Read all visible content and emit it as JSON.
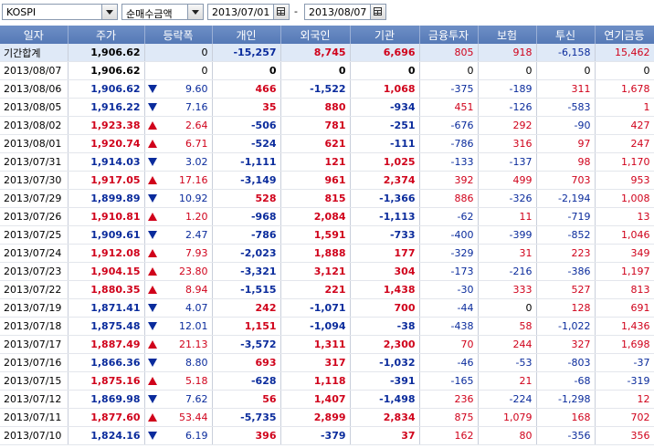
{
  "toolbar": {
    "index_select": "KOSPI",
    "type_select": "순매수금액",
    "start_date": "2013/07/01",
    "end_date": "2013/08/07",
    "range_separator": "-"
  },
  "columns": [
    "일자",
    "주가",
    "등락폭",
    "개인",
    "외국인",
    "기관",
    "금융투자",
    "보험",
    "투신",
    "연기금등"
  ],
  "rows": [
    {
      "date": "기간합계",
      "price": "1,906.62",
      "chg": "0",
      "dir": "none",
      "ind": "-15,257",
      "for": "8,745",
      "inst": "6,696",
      "fin": "805",
      "ins": "918",
      "trust": "-6,158",
      "pen": "15,462",
      "sum": true
    },
    {
      "date": "2013/08/07",
      "price": "1,906.62",
      "chg": "0",
      "dir": "none",
      "ind": "0",
      "for": "0",
      "inst": "0",
      "fin": "0",
      "ins": "0",
      "trust": "0",
      "pen": "0"
    },
    {
      "date": "2013/08/06",
      "price": "1,906.62",
      "chg": "9.60",
      "dir": "down",
      "ind": "466",
      "for": "-1,522",
      "inst": "1,068",
      "fin": "-375",
      "ins": "-189",
      "trust": "311",
      "pen": "1,678"
    },
    {
      "date": "2013/08/05",
      "price": "1,916.22",
      "chg": "7.16",
      "dir": "down",
      "ind": "35",
      "for": "880",
      "inst": "-934",
      "fin": "451",
      "ins": "-126",
      "trust": "-583",
      "pen": "1"
    },
    {
      "date": "2013/08/02",
      "price": "1,923.38",
      "chg": "2.64",
      "dir": "up",
      "ind": "-506",
      "for": "781",
      "inst": "-251",
      "fin": "-676",
      "ins": "292",
      "trust": "-90",
      "pen": "427"
    },
    {
      "date": "2013/08/01",
      "price": "1,920.74",
      "chg": "6.71",
      "dir": "up",
      "ind": "-524",
      "for": "621",
      "inst": "-111",
      "fin": "-786",
      "ins": "316",
      "trust": "97",
      "pen": "247"
    },
    {
      "date": "2013/07/31",
      "price": "1,914.03",
      "chg": "3.02",
      "dir": "down",
      "ind": "-1,111",
      "for": "121",
      "inst": "1,025",
      "fin": "-133",
      "ins": "-137",
      "trust": "98",
      "pen": "1,170"
    },
    {
      "date": "2013/07/30",
      "price": "1,917.05",
      "chg": "17.16",
      "dir": "up",
      "ind": "-3,149",
      "for": "961",
      "inst": "2,374",
      "fin": "392",
      "ins": "499",
      "trust": "703",
      "pen": "953"
    },
    {
      "date": "2013/07/29",
      "price": "1,899.89",
      "chg": "10.92",
      "dir": "down",
      "ind": "528",
      "for": "815",
      "inst": "-1,366",
      "fin": "886",
      "ins": "-326",
      "trust": "-2,194",
      "pen": "1,008"
    },
    {
      "date": "2013/07/26",
      "price": "1,910.81",
      "chg": "1.20",
      "dir": "up",
      "ind": "-968",
      "for": "2,084",
      "inst": "-1,113",
      "fin": "-62",
      "ins": "11",
      "trust": "-719",
      "pen": "13"
    },
    {
      "date": "2013/07/25",
      "price": "1,909.61",
      "chg": "2.47",
      "dir": "down",
      "ind": "-786",
      "for": "1,591",
      "inst": "-733",
      "fin": "-400",
      "ins": "-399",
      "trust": "-852",
      "pen": "1,046"
    },
    {
      "date": "2013/07/24",
      "price": "1,912.08",
      "chg": "7.93",
      "dir": "up",
      "ind": "-2,023",
      "for": "1,888",
      "inst": "177",
      "fin": "-329",
      "ins": "31",
      "trust": "223",
      "pen": "349"
    },
    {
      "date": "2013/07/23",
      "price": "1,904.15",
      "chg": "23.80",
      "dir": "up",
      "ind": "-3,321",
      "for": "3,121",
      "inst": "304",
      "fin": "-173",
      "ins": "-216",
      "trust": "-386",
      "pen": "1,197"
    },
    {
      "date": "2013/07/22",
      "price": "1,880.35",
      "chg": "8.94",
      "dir": "up",
      "ind": "-1,515",
      "for": "221",
      "inst": "1,438",
      "fin": "-30",
      "ins": "333",
      "trust": "527",
      "pen": "813"
    },
    {
      "date": "2013/07/19",
      "price": "1,871.41",
      "chg": "4.07",
      "dir": "down",
      "ind": "242",
      "for": "-1,071",
      "inst": "700",
      "fin": "-44",
      "ins": "0",
      "trust": "128",
      "pen": "691"
    },
    {
      "date": "2013/07/18",
      "price": "1,875.48",
      "chg": "12.01",
      "dir": "down",
      "ind": "1,151",
      "for": "-1,094",
      "inst": "-38",
      "fin": "-438",
      "ins": "58",
      "trust": "-1,022",
      "pen": "1,436"
    },
    {
      "date": "2013/07/17",
      "price": "1,887.49",
      "chg": "21.13",
      "dir": "up",
      "ind": "-3,572",
      "for": "1,311",
      "inst": "2,300",
      "fin": "70",
      "ins": "244",
      "trust": "327",
      "pen": "1,698"
    },
    {
      "date": "2013/07/16",
      "price": "1,866.36",
      "chg": "8.80",
      "dir": "down",
      "ind": "693",
      "for": "317",
      "inst": "-1,032",
      "fin": "-46",
      "ins": "-53",
      "trust": "-803",
      "pen": "-37"
    },
    {
      "date": "2013/07/15",
      "price": "1,875.16",
      "chg": "5.18",
      "dir": "up",
      "ind": "-628",
      "for": "1,118",
      "inst": "-391",
      "fin": "-165",
      "ins": "21",
      "trust": "-68",
      "pen": "-319"
    },
    {
      "date": "2013/07/12",
      "price": "1,869.98",
      "chg": "7.62",
      "dir": "down",
      "ind": "56",
      "for": "1,407",
      "inst": "-1,498",
      "fin": "236",
      "ins": "-224",
      "trust": "-1,298",
      "pen": "12"
    },
    {
      "date": "2013/07/11",
      "price": "1,877.60",
      "chg": "53.44",
      "dir": "up",
      "ind": "-5,735",
      "for": "2,899",
      "inst": "2,834",
      "fin": "875",
      "ins": "1,079",
      "trust": "168",
      "pen": "702"
    },
    {
      "date": "2013/07/10",
      "price": "1,824.16",
      "chg": "6.19",
      "dir": "down",
      "ind": "396",
      "for": "-379",
      "inst": "37",
      "fin": "162",
      "ins": "80",
      "trust": "-356",
      "pen": "356"
    }
  ]
}
